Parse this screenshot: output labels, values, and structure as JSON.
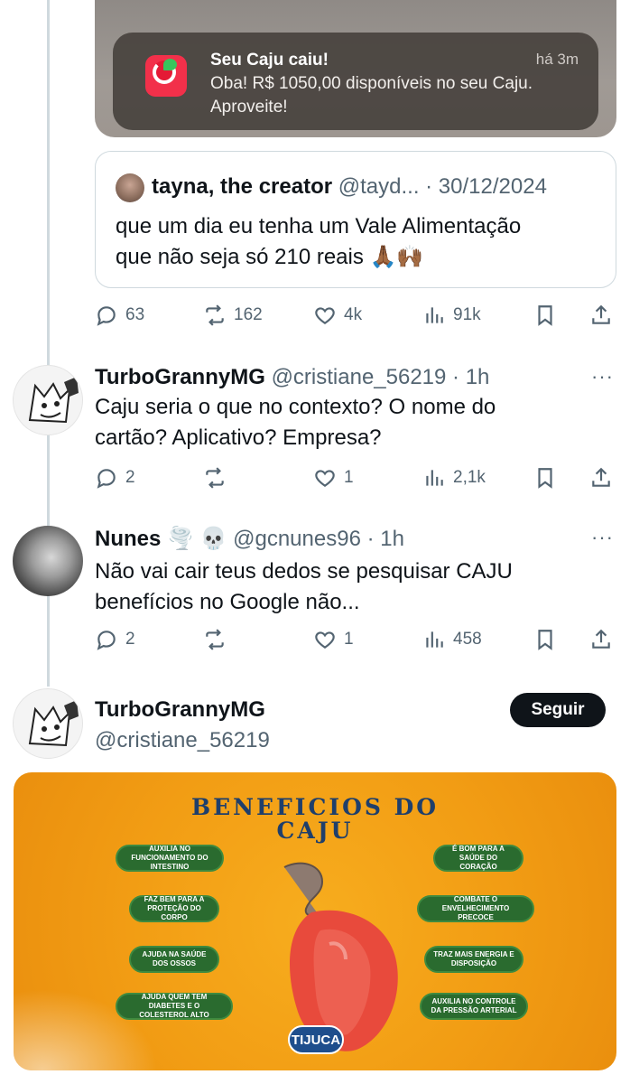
{
  "notification": {
    "title": "Seu Caju caiu!",
    "time": "há 3m",
    "body": "Oba! R$ 1050,00 disponíveis no seu Caju. Aproveite!"
  },
  "quote": {
    "name": "tayna, the creator",
    "meta": "@tayd... · 30/12/2024",
    "text_line1": "que um dia eu tenha um Vale Alimentação",
    "text_line2": "que não seja só 210 reais 🙏🏾🙌🏾"
  },
  "main_actions": {
    "replies": "63",
    "retweets": "162",
    "likes": "4k",
    "views": "91k"
  },
  "replies": [
    {
      "name": "TurboGrannyMG",
      "meta": "@cristiane_56219 · 1h",
      "more": "···",
      "text_line1": "Caju seria o que no contexto? O nome do",
      "text_line2": "cartão? Aplicativo? Empresa?",
      "actions": {
        "replies": "2",
        "retweets": "",
        "likes": "1",
        "views": "2,1k"
      }
    },
    {
      "name": "Nunes 🌪️ 💀",
      "meta": "@gcnunes96 · 1h",
      "more": "···",
      "text_line1": "Não vai cair teus dedos se pesquisar CAJU",
      "text_line2": "benefícios no Google não...",
      "actions": {
        "replies": "2",
        "retweets": "",
        "likes": "1",
        "views": "458"
      }
    }
  ],
  "focused": {
    "name": "TurboGrannyMG",
    "handle": "@cristiane_56219",
    "follow_label": "Seguir"
  },
  "promo": {
    "title_line1": "BENEFICIOS DO",
    "title_line2": "CAJU",
    "left": [
      "AUXILIA NO FUNCIONAMENTO DO INTESTINO",
      "FAZ BEM PARA A PROTEÇÃO DO CORPO",
      "AJUDA NA SAÚDE DOS OSSOS",
      "AJUDA QUEM TEM DIABETES E O COLESTEROL ALTO"
    ],
    "right": [
      "É BOM PARA A SAÚDE DO CORAÇÃO",
      "COMBATE O ENVELHECIMENTO PRECOCE",
      "TRAZ MAIS ENERGIA E DISPOSIÇÃO",
      "AUXILIA NO CONTROLE DA PRESSÃO ARTERIAL"
    ],
    "brand": "TIJUCA"
  },
  "colors": {
    "text": "#0f1419",
    "muted": "#536471",
    "border": "#cfd9de",
    "promo_orange": "#f29d14",
    "pill_green": "#2a6b2f"
  }
}
